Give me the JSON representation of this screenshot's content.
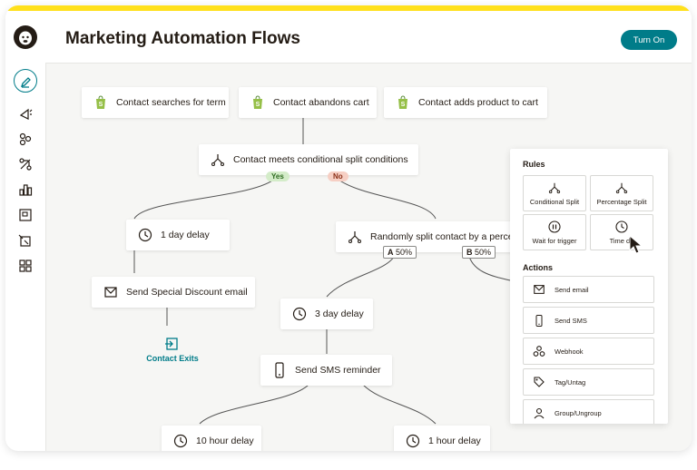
{
  "header": {
    "title": "Marketing Automation Flows",
    "turn_on_label": "Turn On"
  },
  "colors": {
    "accent": "#007c89",
    "brand_yellow": "#ffe01b",
    "dark": "#241c15",
    "yes_pill": "#d4ecc9",
    "no_pill": "#f6cfc4"
  },
  "sidebar": {
    "icons": [
      "pencil-icon",
      "campaign-icon",
      "audience-icon",
      "automations-icon",
      "analytics-icon",
      "content-icon",
      "website-icon",
      "integrations-icon"
    ]
  },
  "flow": {
    "triggers": [
      {
        "label": "Contact searches for term",
        "icon": "shopify-icon"
      },
      {
        "label": "Contact abandons cart",
        "icon": "shopify-icon"
      },
      {
        "label": "Contact adds product to cart",
        "icon": "shopify-icon"
      }
    ],
    "conditional_split": {
      "label": "Contact meets conditional split conditions",
      "yes": "Yes",
      "no": "No"
    },
    "yes_branch": {
      "delay": "1 day delay",
      "email": "Send Special Discount email",
      "exit": "Contact Exits"
    },
    "no_branch": {
      "random_split": "Randomly split contact by a percen",
      "a_letter": "A",
      "a_value": "50%",
      "b_letter": "B",
      "b_value": "50%",
      "delay": "3 day delay",
      "sms": "Send SMS reminder",
      "delay_left": "10 hour delay",
      "delay_right": "1 hour delay"
    }
  },
  "panel": {
    "rules_heading": "Rules",
    "rules": [
      {
        "label": "Conditional Split",
        "icon": "split-icon"
      },
      {
        "label": "Percentage Split",
        "icon": "split-icon"
      },
      {
        "label": "Wait for trigger",
        "icon": "pause-icon"
      },
      {
        "label": "Time de",
        "icon": "clock-icon"
      }
    ],
    "actions_heading": "Actions",
    "actions": [
      {
        "label": "Send email",
        "icon": "envelope-icon"
      },
      {
        "label": "Send SMS",
        "icon": "phone-icon"
      },
      {
        "label": "Webhook",
        "icon": "webhook-icon"
      },
      {
        "label": "Tag/Untag",
        "icon": "tag-icon"
      },
      {
        "label": "Group/Ungroup",
        "icon": "group-icon"
      }
    ]
  }
}
